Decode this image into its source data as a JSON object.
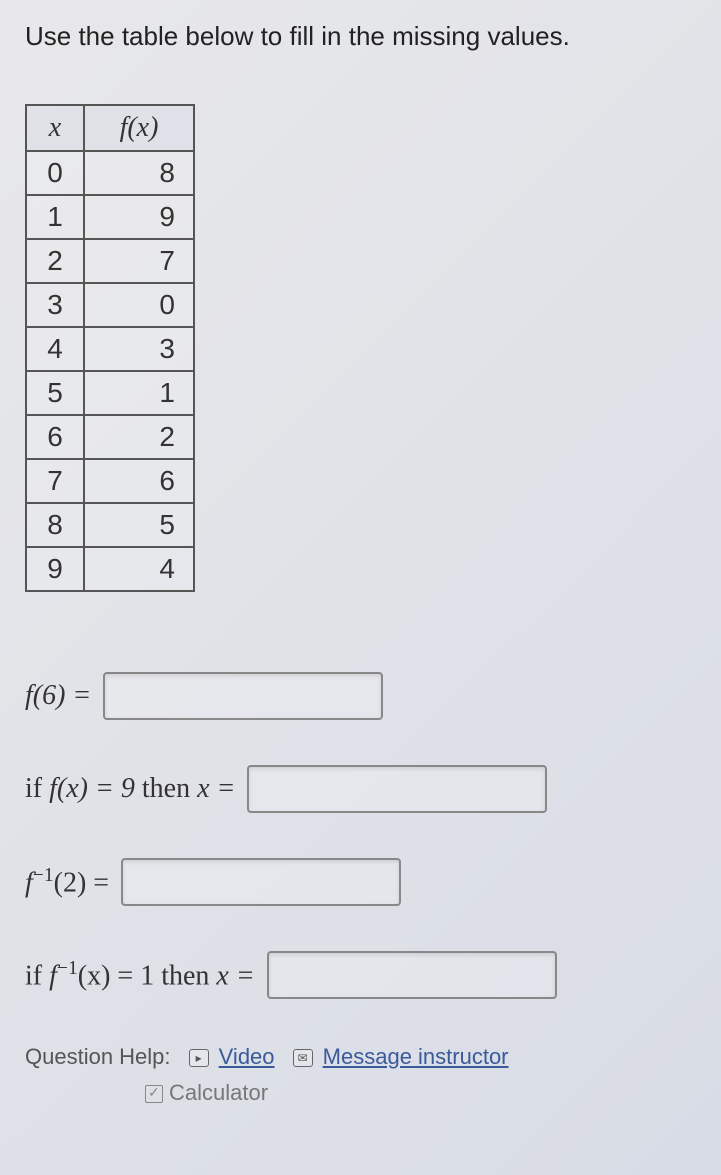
{
  "prompt": "Use the table below to fill in the missing values.",
  "table": {
    "header_x": "x",
    "header_fx": "f(x)",
    "rows": [
      {
        "x": "0",
        "fx": "8"
      },
      {
        "x": "1",
        "fx": "9"
      },
      {
        "x": "2",
        "fx": "7"
      },
      {
        "x": "3",
        "fx": "0"
      },
      {
        "x": "4",
        "fx": "3"
      },
      {
        "x": "5",
        "fx": "1"
      },
      {
        "x": "6",
        "fx": "2"
      },
      {
        "x": "7",
        "fx": "6"
      },
      {
        "x": "8",
        "fx": "5"
      },
      {
        "x": "9",
        "fx": "4"
      }
    ]
  },
  "questions": {
    "q1": {
      "pre": "f(6) =",
      "value": ""
    },
    "q2": {
      "pre_a": "if ",
      "pre_b": "f(x) = 9",
      "pre_c": " then ",
      "pre_d": "x =",
      "value": ""
    },
    "q3": {
      "pre": "f",
      "sup": "−1",
      "post": "(2) =",
      "value": ""
    },
    "q4": {
      "pre_a": "if ",
      "pre_b": "f",
      "sup": "−1",
      "pre_c": "(x) = 1",
      "pre_d": " then ",
      "pre_e": "x =",
      "value": ""
    }
  },
  "help": {
    "label": "Question Help:",
    "video": "Video",
    "message": "Message instructor",
    "calculator": "Calculator",
    "video_glyph": "▸",
    "msg_glyph": "✉"
  }
}
